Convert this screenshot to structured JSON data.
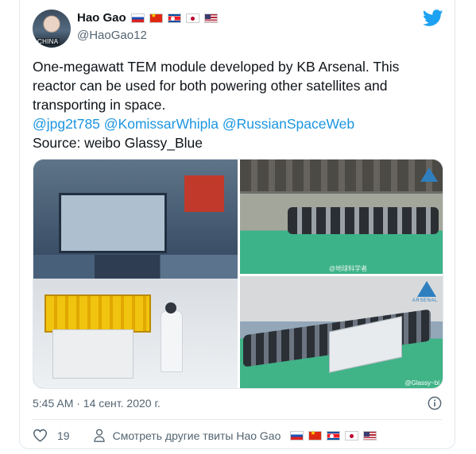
{
  "user": {
    "name": "Hao Gao",
    "handle": "@HaoGao12",
    "avatar_tag": "CHINA",
    "flags": [
      "flag-russia",
      "flag-china",
      "flag-north-korea",
      "flag-japan",
      "flag-usa"
    ]
  },
  "tweet": {
    "line1": "One-megawatt TEM module developed by KB Arsenal. This reactor can be used for both powering other satellites and transporting in space.",
    "mentions": [
      "@jpg2t785",
      "@KomissarWhipla",
      "@RussianSpaceWeb"
    ],
    "source": "Source: weibo Glassy_Blue"
  },
  "media": {
    "watermark_top": "@地球科学者",
    "watermark_bottom": "@Glassy~bl",
    "brand": "ARSENAL"
  },
  "timestamp": "5:45 AM · 14 сент. 2020 г.",
  "actions": {
    "likes": "19",
    "more_tweets": "Смотреть другие твиты Hao Gao"
  },
  "colors": {
    "link": "#1b95e0",
    "twitter_blue": "#1da1f2",
    "heart_gray": "#536471"
  },
  "icons": [
    "twitter-bird-icon",
    "info-icon",
    "heart-icon",
    "user-icon"
  ]
}
